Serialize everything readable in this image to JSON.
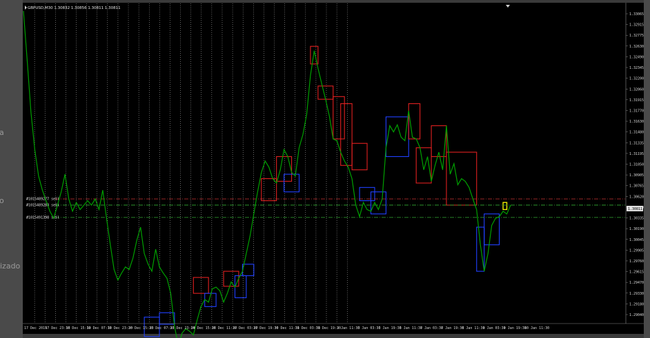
{
  "window": {
    "symbol_header": "GBPUSD,M30  1.30832 1.30856 1.30811 1.30811",
    "current_price": "1.30811",
    "background_color": "#000000",
    "price_line_color": "#00aa00"
  },
  "side_fragments": {
    "left_a": "a",
    "left_o": "o",
    "left_izado": "izado"
  },
  "levels": [
    {
      "label": "#1015489277 sell",
      "price": 1.3092,
      "color": "#cc3333",
      "style": "dashdot"
    },
    {
      "label": "#1015489288 sell",
      "price": 1.3085,
      "color": "#33aa33",
      "style": "dashdot"
    },
    {
      "label": "#1015491398 sell",
      "price": 1.3071,
      "color": "#33aa33",
      "style": "dashdot"
    }
  ],
  "chart_data": {
    "type": "line",
    "title": "GBPUSD,M30",
    "xlabel": "",
    "ylabel": "",
    "grid": "vertical dotted",
    "ylim": [
      1.2957,
      1.3305
    ],
    "y_ticks": [
      "1.33065",
      "1.32915",
      "1.32775",
      "1.32630",
      "1.32490",
      "1.32345",
      "1.32200",
      "1.32060",
      "1.31915",
      "1.31770",
      "1.31630",
      "1.31480",
      "1.31335",
      "1.31195",
      "1.31050",
      "1.30905",
      "1.30765",
      "1.30620",
      "1.30480",
      "1.30335",
      "1.30190",
      "1.30045",
      "1.29905",
      "1.29760",
      "1.29615",
      "1.29470",
      "1.29330",
      "1.29180",
      "1.29040"
    ],
    "x_ticks": [
      "17 Dec 2019",
      "17 Dec 23:30",
      "18 Dec 15:30",
      "19 Dec 07:30",
      "19 Dec 23:30",
      "20 Dec 15:30",
      "23 Dec 07:30",
      "23 Dec 23:30",
      "24 Dec 15:30",
      "26 Dec 11:30",
      "27 Dec 03:30",
      "27 Dec 19:30",
      "30 Dec 11:30",
      "31 Dec 03:30",
      "31 Dec 19:30",
      "2 Jan 11:30",
      "3 Jan 03:30",
      "3 Jan 19:30",
      "6 Jan 11:30",
      "7 Jan 03:30",
      "7 Jan 19:30",
      "8 Jan 11:30",
      "9 Jan 03:30",
      "9 Jan 19:30",
      "10 Jan 11:30"
    ],
    "series": [
      {
        "color": "#00a000",
        "values": [
          1.3305,
          1.3248,
          1.319,
          1.3148,
          1.3118,
          1.3102,
          1.309,
          1.3078,
          1.307,
          1.3085,
          1.31,
          1.312,
          1.3092,
          1.3078,
          1.3088,
          1.308,
          1.3085,
          1.309,
          1.3085,
          1.3092,
          1.308,
          1.3102,
          1.307,
          1.304,
          1.3012,
          1.3,
          1.3008,
          1.3015,
          1.3012,
          1.3025,
          1.3045,
          1.306,
          1.303,
          1.3018,
          1.301,
          1.3035,
          1.3015,
          1.3008,
          1.3002,
          1.2985,
          1.2948,
          1.2925,
          1.294,
          1.2945,
          1.2942,
          1.2938,
          1.2955,
          1.297,
          1.2978,
          1.2975,
          1.299,
          1.2992,
          1.2988,
          1.2975,
          1.2985,
          1.2998,
          1.2992,
          1.3002,
          1.301,
          1.303,
          1.305,
          1.3075,
          1.31,
          1.3122,
          1.3135,
          1.3128,
          1.3115,
          1.311,
          1.3125,
          1.3148,
          1.314,
          1.3122,
          1.3118,
          1.315,
          1.3165,
          1.3188,
          1.3232,
          1.326,
          1.324,
          1.3222,
          1.3205,
          1.3186,
          1.316,
          1.3158,
          1.3145,
          1.3135,
          1.3128,
          1.3115,
          1.3085,
          1.3072,
          1.3088,
          1.308,
          1.3078,
          1.3088,
          1.308,
          1.3092,
          1.315,
          1.3175,
          1.3168,
          1.3176,
          1.3162,
          1.3158,
          1.3192,
          1.3162,
          1.316,
          1.315,
          1.3125,
          1.314,
          1.3112,
          1.313,
          1.3145,
          1.3125,
          1.3175,
          1.312,
          1.3132,
          1.3108,
          1.3115,
          1.3112,
          1.3105,
          1.3092,
          1.308,
          1.304,
          1.301,
          1.303,
          1.3062,
          1.307,
          1.3072,
          1.3078,
          1.3075,
          1.3085
        ]
      }
    ],
    "boxes": [
      {
        "t0": 32,
        "t1": 36,
        "high": 1.2958,
        "low": 1.2936,
        "color": "blue"
      },
      {
        "t0": 36,
        "t1": 40,
        "high": 1.2963,
        "low": 1.295,
        "color": "blue"
      },
      {
        "t0": 45,
        "t1": 49,
        "high": 1.3003,
        "low": 1.2985,
        "color": "red"
      },
      {
        "t0": 48,
        "t1": 51,
        "high": 1.2985,
        "low": 1.297,
        "color": "blue"
      },
      {
        "t0": 53,
        "t1": 57,
        "high": 1.301,
        "low": 1.2993,
        "color": "red"
      },
      {
        "t0": 56,
        "t1": 59,
        "high": 1.3005,
        "low": 1.298,
        "color": "blue"
      },
      {
        "t0": 58,
        "t1": 61,
        "high": 1.3018,
        "low": 1.3005,
        "color": "blue"
      },
      {
        "t0": 63,
        "t1": 67,
        "high": 1.3115,
        "low": 1.309,
        "color": "red"
      },
      {
        "t0": 67,
        "t1": 71,
        "high": 1.314,
        "low": 1.3112,
        "color": "red"
      },
      {
        "t0": 69,
        "t1": 73,
        "high": 1.312,
        "low": 1.31,
        "color": "blue"
      },
      {
        "t0": 76,
        "t1": 78,
        "high": 1.3265,
        "low": 1.3245,
        "color": "red"
      },
      {
        "t0": 78,
        "t1": 82,
        "high": 1.322,
        "low": 1.3205,
        "color": "red"
      },
      {
        "t0": 82,
        "t1": 85,
        "high": 1.3208,
        "low": 1.316,
        "color": "red"
      },
      {
        "t0": 84,
        "t1": 87,
        "high": 1.32,
        "low": 1.313,
        "color": "red"
      },
      {
        "t0": 87,
        "t1": 91,
        "high": 1.3155,
        "low": 1.3125,
        "color": "red"
      },
      {
        "t0": 89,
        "t1": 93,
        "high": 1.3105,
        "low": 1.309,
        "color": "blue"
      },
      {
        "t0": 92,
        "t1": 96,
        "high": 1.31,
        "low": 1.3075,
        "color": "blue"
      },
      {
        "t0": 96,
        "t1": 102,
        "high": 1.3185,
        "low": 1.314,
        "color": "blue"
      },
      {
        "t0": 102,
        "t1": 105,
        "high": 1.32,
        "low": 1.316,
        "color": "red"
      },
      {
        "t0": 104,
        "t1": 108,
        "high": 1.315,
        "low": 1.311,
        "color": "red"
      },
      {
        "t0": 108,
        "t1": 112,
        "high": 1.3175,
        "low": 1.314,
        "color": "red"
      },
      {
        "t0": 112,
        "t1": 120,
        "high": 1.3145,
        "low": 1.3085,
        "color": "red"
      },
      {
        "t0": 120,
        "t1": 122,
        "high": 1.306,
        "low": 1.301,
        "color": "blue"
      },
      {
        "t0": 122,
        "t1": 126,
        "high": 1.3075,
        "low": 1.304,
        "color": "blue"
      },
      {
        "t0": 127,
        "t1": 128,
        "high": 1.3088,
        "low": 1.308,
        "color": "yellow"
      }
    ]
  }
}
